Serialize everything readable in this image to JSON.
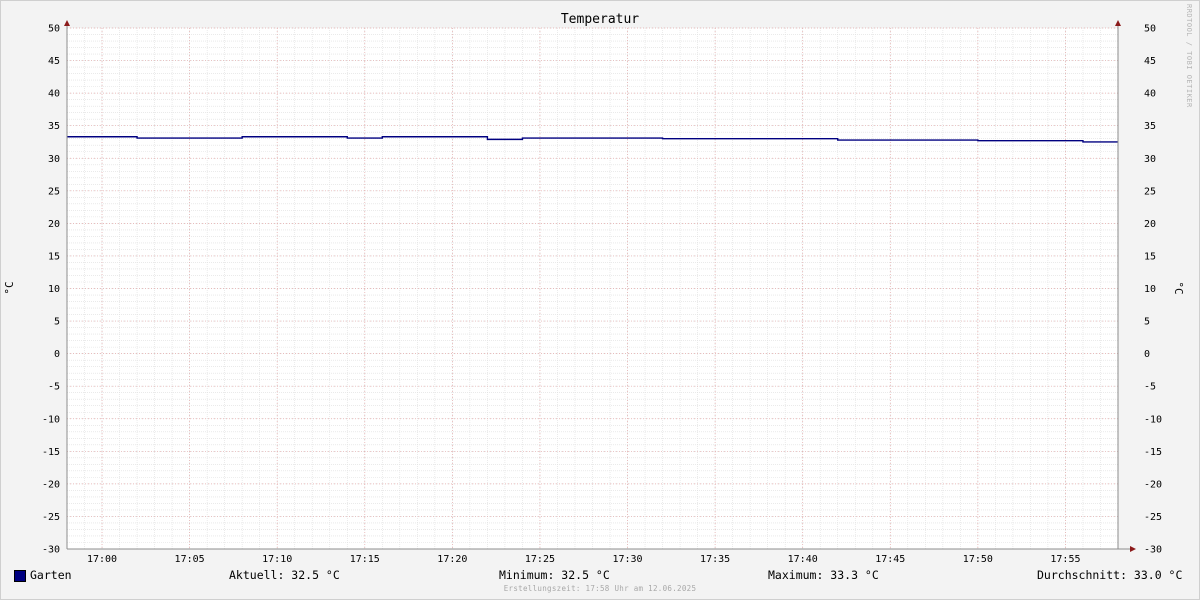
{
  "chart_data": {
    "type": "line",
    "title": "Temperatur",
    "ylabel": "°C",
    "ylim": [
      -30,
      50
    ],
    "yticks": [
      50,
      45,
      40,
      35,
      30,
      25,
      20,
      15,
      10,
      5,
      0,
      -5,
      -10,
      -15,
      -20,
      -25,
      -30
    ],
    "xlim": [
      "16:58",
      "17:58"
    ],
    "xticks": [
      "17:00",
      "17:05",
      "17:10",
      "17:15",
      "17:20",
      "17:25",
      "17:30",
      "17:35",
      "17:40",
      "17:45",
      "17:50",
      "17:55"
    ],
    "grid": true,
    "series": [
      {
        "name": "Garten",
        "color": "#000080",
        "x": [
          "16:58",
          "17:02",
          "17:08",
          "17:14",
          "17:16",
          "17:22",
          "17:24",
          "17:32",
          "17:42",
          "17:50",
          "17:56",
          "17:58"
        ],
        "y": [
          33.3,
          33.1,
          33.3,
          33.1,
          33.3,
          32.9,
          33.1,
          33.0,
          32.8,
          32.7,
          32.5,
          32.5
        ]
      }
    ]
  },
  "legend": {
    "series_name": "Garten",
    "current": "Aktuell: 32.5 °C",
    "minimum": "Minimum: 32.5 °C",
    "maximum": "Maximum: 33.3 °C",
    "average": "Durchschnitt: 33.0 °C"
  },
  "watermark": "RRDTOOL / TOBI OETIKER",
  "footer": "Erstellungszeit: 17:58 Uhr am 12.06.2025"
}
